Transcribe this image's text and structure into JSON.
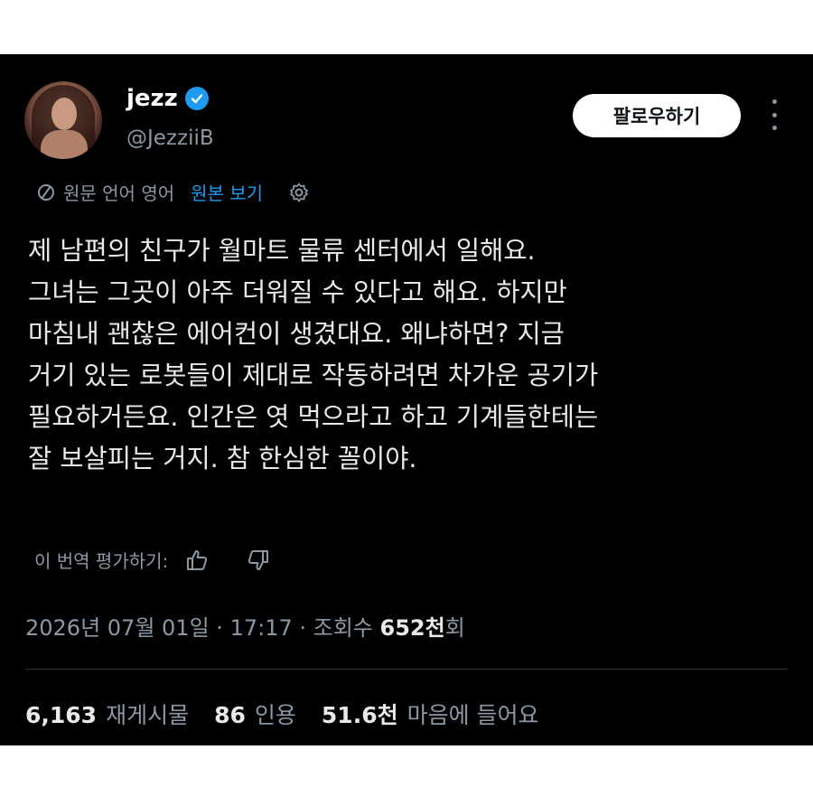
{
  "user": {
    "display_name": "jezz",
    "handle": "@JezziiB",
    "verified": true
  },
  "follow_button": "팔로우하기",
  "translation": {
    "source_language": "원문 언어 영어",
    "view_original": "원본 보기"
  },
  "tweet": {
    "text": "제 남편의 친구가 월마트 물류 센터에서 일해요.\n그녀는 그곳이 아주 더워질 수 있다고 해요. 하지만\n마침내 괜찮은 에어컨이 생겼대요. 왜냐하면? 지금\n거기 있는 로봇들이 제대로 작동하려면 차가운 공기가\n필요하거든요. 인간은 엿 먹으라고 하고 기계들한테는\n잘 보살피는 거지. 참 한심한 꼴이야."
  },
  "rate_translation": "이 번역 평가하기:",
  "meta": {
    "date": "2026년 07월 01일",
    "time": "17:17",
    "views_label": "조회수",
    "views_value": "652천",
    "views_suffix": "회",
    "separator": "·"
  },
  "stats": {
    "reposts_value": "6,163",
    "reposts_label": "재게시물",
    "quotes_value": "86",
    "quotes_label": "인용",
    "likes_value": "51.6천",
    "likes_label": "마음에 들어요"
  },
  "colors": {
    "background": "#000000",
    "text": "#e7e9ea",
    "secondary": "#8b98a5",
    "accent": "#1d9bf0"
  },
  "icons": [
    "verified-badge-icon",
    "more-icon",
    "translate-icon",
    "gear-icon",
    "thumbs-up-icon",
    "thumbs-down-icon"
  ]
}
